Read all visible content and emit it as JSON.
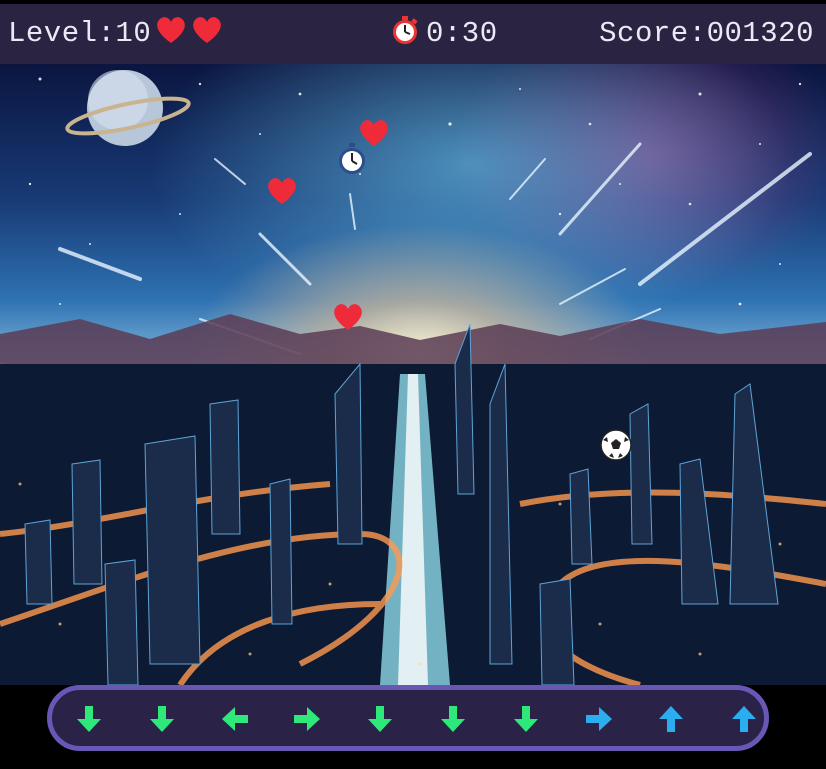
{
  "hud": {
    "level_label": "Level:10",
    "lives": 2,
    "timer": "0:30",
    "score_label": "Score:001320",
    "icons": {
      "heart": "heart-icon",
      "timer": "stopwatch-icon"
    }
  },
  "scene": {
    "falling_items": [
      "heart",
      "heart",
      "heart",
      "stopwatch",
      "soccer-ball"
    ]
  },
  "arrow_sequence": [
    {
      "direction": "down",
      "color": "#2ee87a"
    },
    {
      "direction": "down",
      "color": "#2ee87a"
    },
    {
      "direction": "left",
      "color": "#2ee87a"
    },
    {
      "direction": "right",
      "color": "#2ee87a"
    },
    {
      "direction": "down",
      "color": "#2ee87a"
    },
    {
      "direction": "down",
      "color": "#2ee87a"
    },
    {
      "direction": "down",
      "color": "#2ee87a"
    },
    {
      "direction": "right",
      "color": "#2aaef0"
    },
    {
      "direction": "up",
      "color": "#2aaef0"
    },
    {
      "direction": "up",
      "color": "#2aaef0"
    }
  ],
  "colors": {
    "hud_bg": "#2b2342",
    "bar_bg": "#2a2347",
    "bar_border": "#6a57b5",
    "text": "#ece8f6"
  }
}
